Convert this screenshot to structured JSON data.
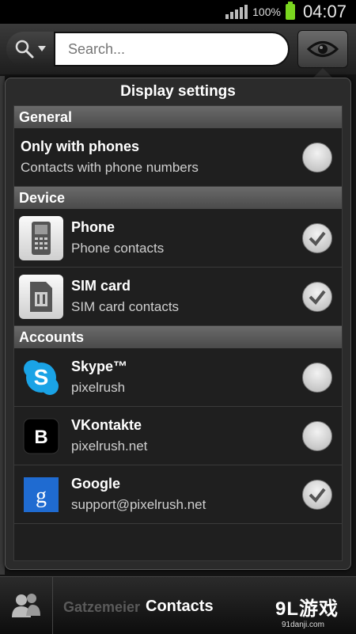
{
  "status_bar": {
    "battery_percent": "100%",
    "time": "04:07",
    "battery_color": "#7ad61f"
  },
  "search": {
    "placeholder": "Search..."
  },
  "dialog": {
    "title": "Display settings",
    "sections": [
      {
        "header": "General"
      },
      {
        "header": "Device"
      },
      {
        "header": "Accounts"
      }
    ],
    "items": [
      {
        "title": "Only with phones",
        "subtitle": "Contacts with phone numbers",
        "checked": false
      },
      {
        "title": "Phone",
        "subtitle": "Phone contacts",
        "icon": "phone-icon",
        "checked": true
      },
      {
        "title": "SIM card",
        "subtitle": "SIM card contacts",
        "icon": "sim-card-icon",
        "checked": true
      },
      {
        "title": "Skype™",
        "subtitle": "pixelrush",
        "icon": "skype-icon",
        "checked": false
      },
      {
        "title": "VKontakte",
        "subtitle": "pixelrush.net",
        "icon": "vkontakte-icon",
        "checked": false
      },
      {
        "title": "Google",
        "subtitle": "support@pixelrush.net",
        "icon": "google-icon",
        "checked": true
      }
    ]
  },
  "bottom_bar": {
    "label": "Contacts",
    "ghost_text": "Gatzemeier",
    "watermark": "9L游戏",
    "watermark_sub": "91danji.com"
  },
  "colors": {
    "accent_skype": "#1aa3e6",
    "google_blue": "#1f6bd1",
    "header_bg": "#5a5a5a"
  }
}
